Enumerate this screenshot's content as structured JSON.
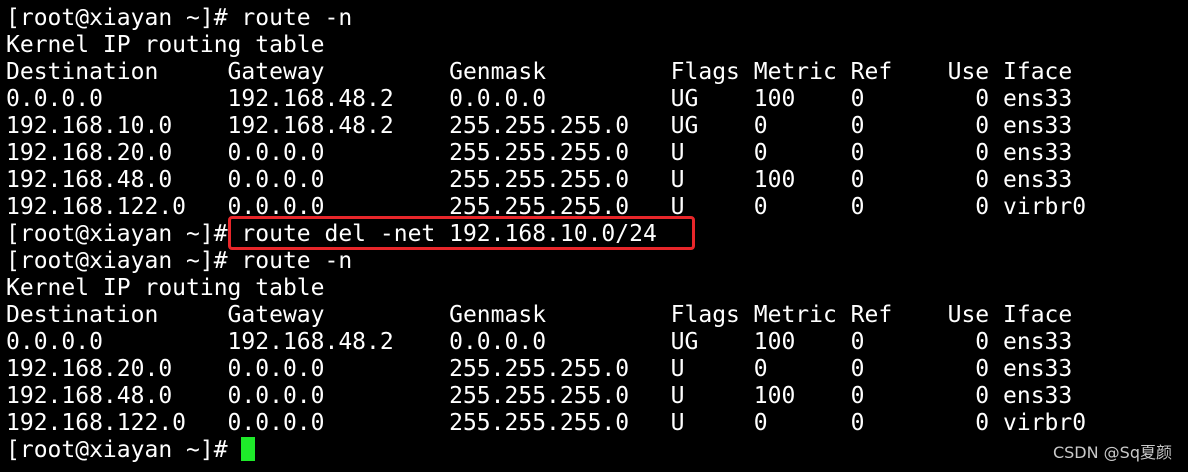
{
  "terminal": {
    "lines": [
      "[root@xiayan ~]# route -n",
      "Kernel IP routing table",
      "Destination     Gateway         Genmask         Flags Metric Ref    Use Iface",
      "0.0.0.0         192.168.48.2    0.0.0.0         UG    100    0        0 ens33",
      "192.168.10.0    192.168.48.2    255.255.255.0   UG    0      0        0 ens33",
      "192.168.20.0    0.0.0.0         255.255.255.0   U     0      0        0 ens33",
      "192.168.48.0    0.0.0.0         255.255.255.0   U     100    0        0 ens33",
      "192.168.122.0   0.0.0.0         255.255.255.0   U     0      0        0 virbr0",
      "[root@xiayan ~]# route del -net 192.168.10.0/24",
      "[root@xiayan ~]# route -n",
      "Kernel IP routing table",
      "Destination     Gateway         Genmask         Flags Metric Ref    Use Iface",
      "0.0.0.0         192.168.48.2    0.0.0.0         UG    100    0        0 ens33",
      "192.168.20.0    0.0.0.0         255.255.255.0   U     0      0        0 ens33",
      "192.168.48.0    0.0.0.0         255.255.255.0   U     100    0        0 ens33",
      "192.168.122.0   0.0.0.0         255.255.255.0   U     0      0        0 virbr0"
    ],
    "prompt": "[root@xiayan ~]# "
  },
  "watermark": "CSDN @Sq夏颜",
  "colors": {
    "background": "#000000",
    "text": "#ffffff",
    "cursor": "#1eea2a",
    "highlight_box": "#e8262a",
    "watermark": "#c9c9c9"
  }
}
